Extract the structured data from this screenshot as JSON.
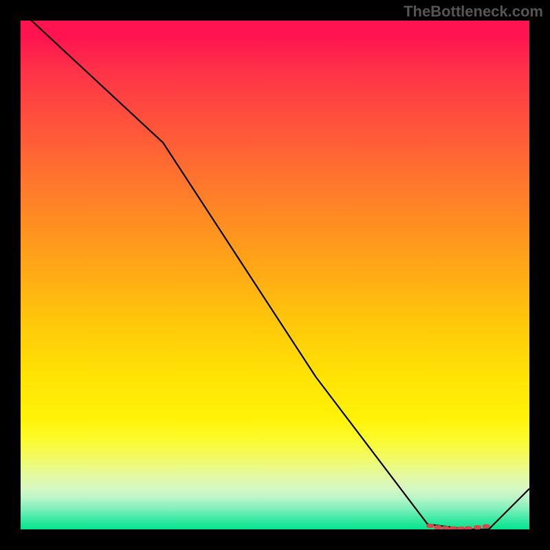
{
  "watermark": "TheBottleneck.com",
  "chart_data": {
    "type": "line",
    "title": "",
    "xlabel": "",
    "ylabel": "",
    "xlim": [
      0,
      100
    ],
    "ylim": [
      0,
      100
    ],
    "series": [
      {
        "name": "curve",
        "x": [
          0,
          28,
          58,
          80,
          88,
          92,
          100
        ],
        "y": [
          102,
          76,
          30,
          1,
          0,
          0,
          8
        ],
        "color": "#000000"
      }
    ],
    "markers": {
      "name": "highlight-band",
      "color": "#d44a4a",
      "points": [
        {
          "x": 80.5,
          "y": 0.7
        },
        {
          "x": 82.0,
          "y": 0.4
        },
        {
          "x": 83.5,
          "y": 0.25
        },
        {
          "x": 85.0,
          "y": 0.18
        },
        {
          "x": 86.5,
          "y": 0.15
        },
        {
          "x": 88.0,
          "y": 0.22
        },
        {
          "x": 89.8,
          "y": 0.4
        },
        {
          "x": 91.5,
          "y": 0.6
        }
      ]
    }
  },
  "colors": {
    "background": "#000000",
    "gradient_top": "#ff1350",
    "gradient_mid": "#ffe304",
    "gradient_bottom": "#04e38d",
    "line": "#000000",
    "marker": "#d44a4a"
  }
}
